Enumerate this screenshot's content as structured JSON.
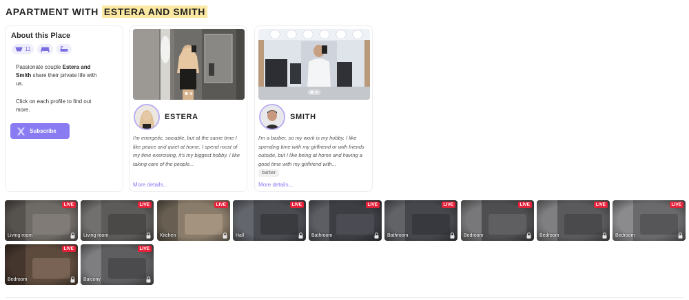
{
  "title": {
    "prefix": "APARTMENT WITH",
    "highlight": "ESTERA AND SMITH"
  },
  "about": {
    "heading": "About this Place",
    "chips": [
      {
        "icon": "bowl-icon",
        "value": "11"
      },
      {
        "icon": "bed-icon",
        "value": ""
      },
      {
        "icon": "bathtub-icon",
        "value": ""
      }
    ],
    "p1_a": "Passionate couple ",
    "p1_b": "Estera and Smith",
    "p1_c": " share their private life with us.",
    "p2": "Click on each profile to find out more.",
    "subscribe": "Subscribe"
  },
  "profiles": [
    {
      "name": "ESTERA",
      "bio": "I'm energetic, sociable, but at the same time I like peace and quiet at home. I spend most of my time exercising, it's my biggest hobby. I like taking care of the people...",
      "tag": "",
      "more": "More details..."
    },
    {
      "name": "SMITH",
      "bio": "I'm a barber, so my work is my hobby. I like spending time with my girlfriend or with friends outside, but I like being at home and having a good time with my girlfriend with...",
      "tag": "barber",
      "more": "More details..."
    }
  ],
  "live_badge": "LIVE",
  "cameras": [
    {
      "label": "Living room"
    },
    {
      "label": "Living room"
    },
    {
      "label": "Kitchen"
    },
    {
      "label": "Hall"
    },
    {
      "label": "Bathroom"
    },
    {
      "label": "Bathroom"
    },
    {
      "label": "Bedroom"
    },
    {
      "label": "Bedroom"
    },
    {
      "label": "Bedroom"
    },
    {
      "label": "Bedroom"
    },
    {
      "label": "Balcony"
    }
  ],
  "colors": {
    "accent": "#8a7bf2",
    "highlight": "#fbe8a3",
    "live": "#e8213a"
  }
}
